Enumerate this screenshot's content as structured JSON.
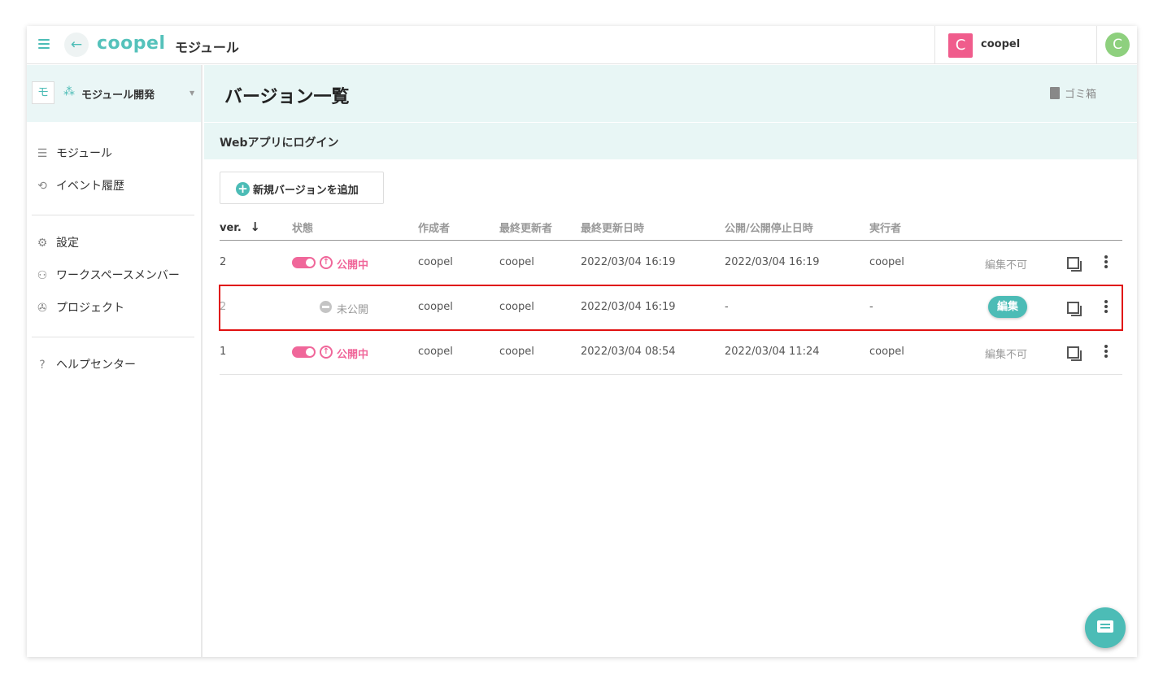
{
  "header": {
    "logo": "coopel",
    "app_title": "モジュール",
    "back_icon": "←",
    "workspace": {
      "badge": "C",
      "name": "coopel"
    },
    "user_avatar": "C"
  },
  "sidebar": {
    "project": {
      "badge": "モ",
      "icon": "⁂",
      "name": "モジュール開発",
      "caret": "▼"
    },
    "items": [
      {
        "icon": "☰",
        "label": "モジュール"
      },
      {
        "icon": "⟲",
        "label": "イベント履歴"
      },
      {
        "icon": "⚙",
        "label": "設定"
      },
      {
        "icon": "⚇",
        "label": "ワークスペースメンバー"
      },
      {
        "icon": "✇",
        "label": "プロジェクト"
      },
      {
        "icon": "?",
        "label": "ヘルプセンター"
      }
    ]
  },
  "main": {
    "title": "バージョン一覧",
    "trash_label": "ゴミ箱",
    "module_name": "Webアプリにログイン",
    "add_version_label": "新規バージョンを追加",
    "columns": {
      "ver": "ver.",
      "sort_icon": "↓",
      "status": "状態",
      "creator": "作成者",
      "updater": "最終更新者",
      "updated_at": "最終更新日時",
      "published_at": "公開/公開停止日時",
      "executor": "実行者"
    },
    "rows": [
      {
        "ver": "2",
        "status": "公開中",
        "creator": "coopel",
        "updater": "coopel",
        "updated_at": "2022/03/04 16:19",
        "published_at": "2022/03/04 16:19",
        "executor": "coopel",
        "edit": "編集不可"
      },
      {
        "ver": "2",
        "status": "未公開",
        "creator": "coopel",
        "updater": "coopel",
        "updated_at": "2022/03/04 16:19",
        "published_at": "-",
        "executor": "-",
        "edit": "編集"
      },
      {
        "ver": "1",
        "status": "公開中",
        "creator": "coopel",
        "updater": "coopel",
        "updated_at": "2022/03/04 08:54",
        "published_at": "2022/03/04 11:24",
        "executor": "coopel",
        "edit": "編集不可"
      }
    ]
  },
  "colors": {
    "accent": "#4cbcb6",
    "published": "#f0679a",
    "workspace_badge": "#f05c8c",
    "avatar": "#8ed07e",
    "selection_outline": "#e01010"
  }
}
